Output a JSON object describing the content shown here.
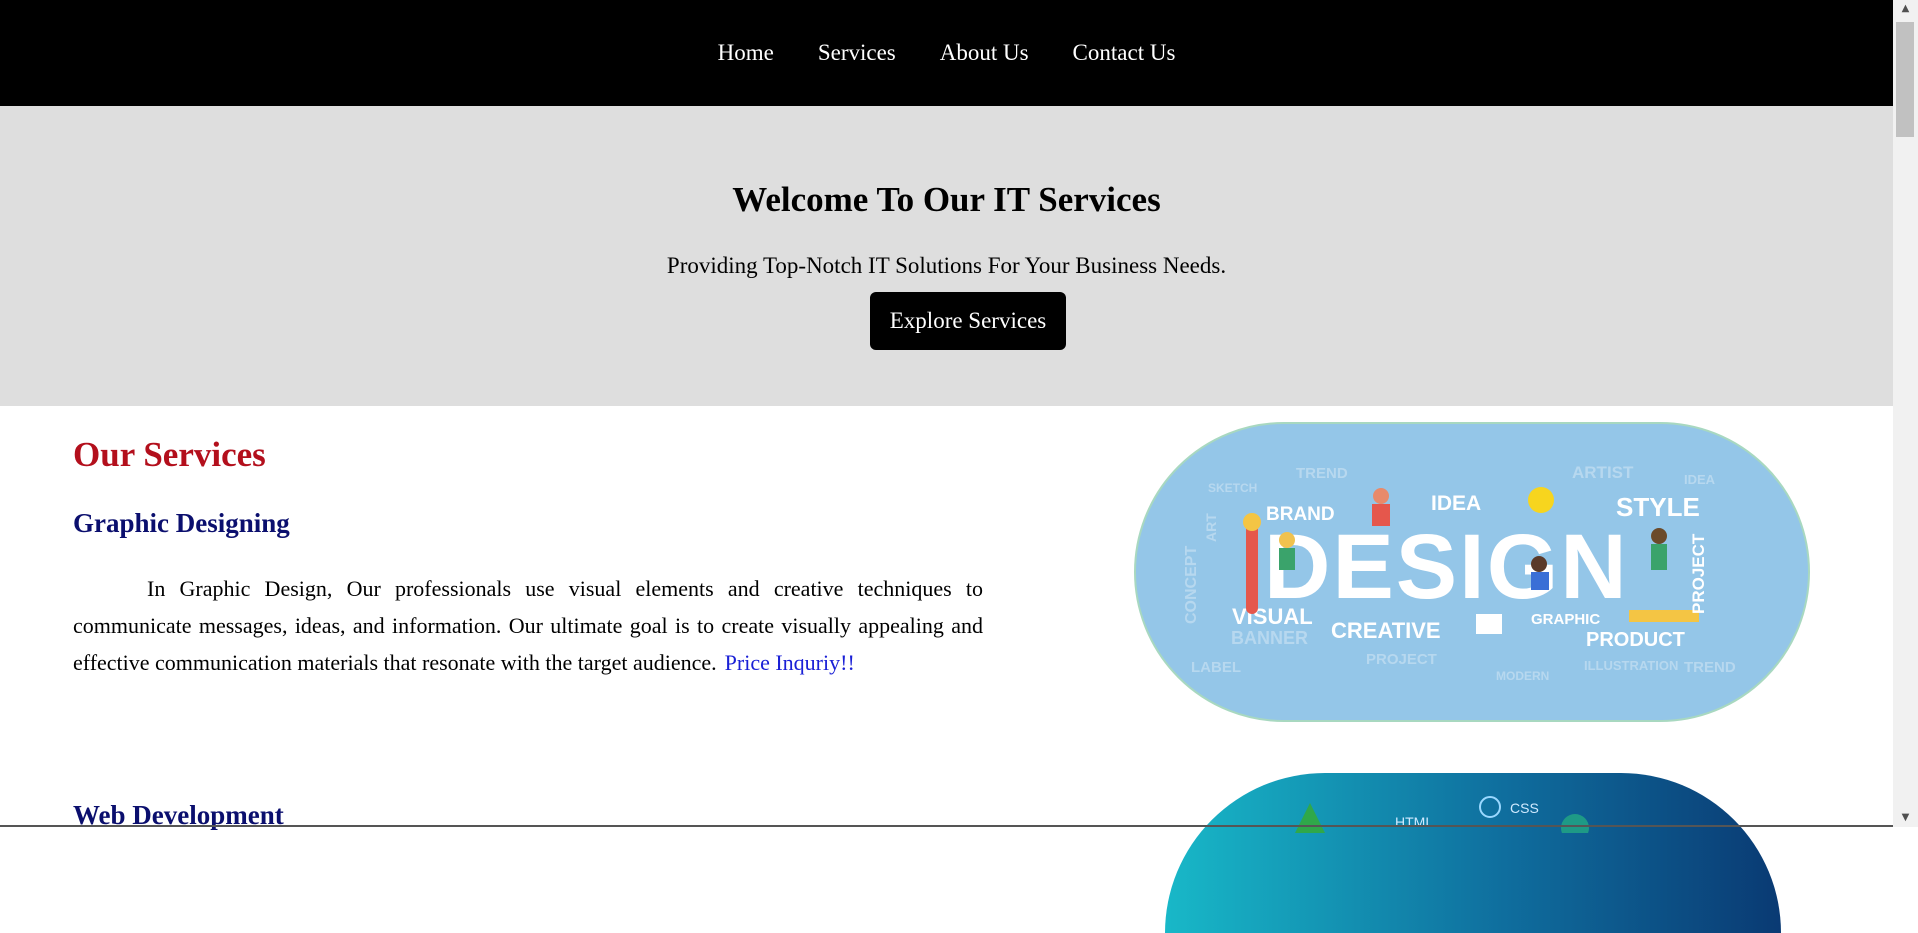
{
  "nav": {
    "items": [
      "Home",
      "Services",
      "About Us",
      "Contact Us"
    ]
  },
  "hero": {
    "title": "Welcome To Our IT Services",
    "subtitle": "Providing Top-Notch IT Solutions For Your Business Needs.",
    "button_label": "Explore Services"
  },
  "services": {
    "heading": "Our Services",
    "items": [
      {
        "title": "Graphic Designing",
        "description": "In Graphic Design, Our professionals use visual elements and creative techniques to communicate messages, ideas, and information. Our ultimate goal is to create visually appealing and effective communication materials that resonate with the target audience.",
        "link_label": "Price Inquriy!!"
      },
      {
        "title": "Web Development"
      }
    ]
  },
  "images": {
    "design": {
      "main_word": "DESIGN",
      "words": [
        "BRAND",
        "IDEA",
        "STYLE",
        "VISUAL",
        "CREATIVE",
        "GRAPHIC",
        "PRODUCT",
        "BANNER",
        "PROJECT",
        "TREND",
        "ARTIST",
        "SKETCH",
        "LABEL",
        "CONCEPT",
        "ART",
        "MODERN",
        "ILLUSTRATION",
        "IDEA",
        "TREND"
      ]
    },
    "web": {
      "words": [
        "HTML",
        "CSS"
      ]
    }
  },
  "colors": {
    "nav_bg": "#000000",
    "hero_bg": "#dedede",
    "section_heading": "#b30f1c",
    "service_title": "#0b0f6e",
    "link": "#1a20d6"
  }
}
